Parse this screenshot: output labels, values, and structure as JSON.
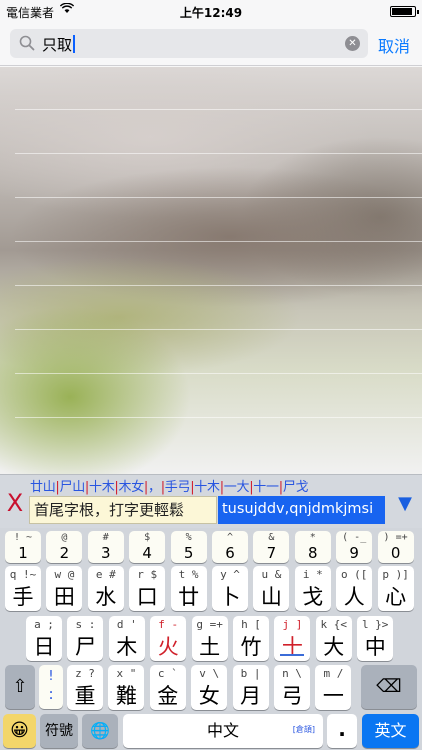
{
  "status": {
    "carrier": "電信業者",
    "time": "上午12:49",
    "battery_level": 0.9
  },
  "search": {
    "query": "只取",
    "cancel_label": "取消"
  },
  "candidates": {
    "close_label": "X",
    "roots": [
      "廿山",
      "尸山",
      "十木",
      "木女",
      "，",
      "手弓",
      "十木",
      "一大",
      "十一",
      "尸戈"
    ],
    "hint": "首尾字根，打字更輕鬆",
    "code": "tusujddv,qnjdmkjmsi",
    "expand_icon": "▼"
  },
  "keyboard": {
    "row1": [
      {
        "sym": "! ~",
        "big": "1"
      },
      {
        "sym": "@",
        "big": "2"
      },
      {
        "sym": "#",
        "big": "3"
      },
      {
        "sym": "$",
        "big": "4"
      },
      {
        "sym": "%",
        "big": "5"
      },
      {
        "sym": "^",
        "big": "6"
      },
      {
        "sym": "&",
        "big": "7"
      },
      {
        "sym": "*",
        "big": "8"
      },
      {
        "sym": "( -_",
        "big": "9"
      },
      {
        "sym": ") =+",
        "big": "0"
      }
    ],
    "row2": [
      {
        "sym": "q !~",
        "big": "手"
      },
      {
        "sym": "w @",
        "big": "田"
      },
      {
        "sym": "e #",
        "big": "水"
      },
      {
        "sym": "r $",
        "big": "口"
      },
      {
        "sym": "t %",
        "big": "廿"
      },
      {
        "sym": "y ^",
        "big": "卜"
      },
      {
        "sym": "u &",
        "big": "山"
      },
      {
        "sym": "i *",
        "big": "戈"
      },
      {
        "sym": "o ([",
        "big": "人"
      },
      {
        "sym": "p )]",
        "big": "心"
      }
    ],
    "row3": [
      {
        "sym": "a ;",
        "big": "日"
      },
      {
        "sym": "s :",
        "big": "尸"
      },
      {
        "sym": "d '",
        "big": "木"
      },
      {
        "sym": "f -",
        "big": "火"
      },
      {
        "sym": "g =+",
        "big": "土"
      },
      {
        "sym": "h [",
        "big": "竹"
      },
      {
        "sym": "j ]",
        "big": "十"
      },
      {
        "sym": "k {<",
        "big": "大"
      },
      {
        "sym": "l }>",
        "big": "中"
      }
    ],
    "row4": [
      {
        "sym": "z ?",
        "big": "重"
      },
      {
        "sym": "x \"",
        "big": "難"
      },
      {
        "sym": "c `",
        "big": "金"
      },
      {
        "sym": "v \\",
        "big": "女"
      },
      {
        "sym": "b |",
        "big": "月"
      },
      {
        "sym": "n \\",
        "big": "弓"
      },
      {
        "sym": "m /",
        "big": "一"
      }
    ],
    "shift_icon": "⇧",
    "punct_top": "!",
    "punct_bottom": ":",
    "delete_icon": "⌫",
    "emoji_icon": "😀",
    "symbol_label": "符號",
    "globe_icon": "🌐",
    "space_label": "中文",
    "space_tag": "[倉頡]",
    "period_label": ".",
    "lang_label": "英文"
  }
}
